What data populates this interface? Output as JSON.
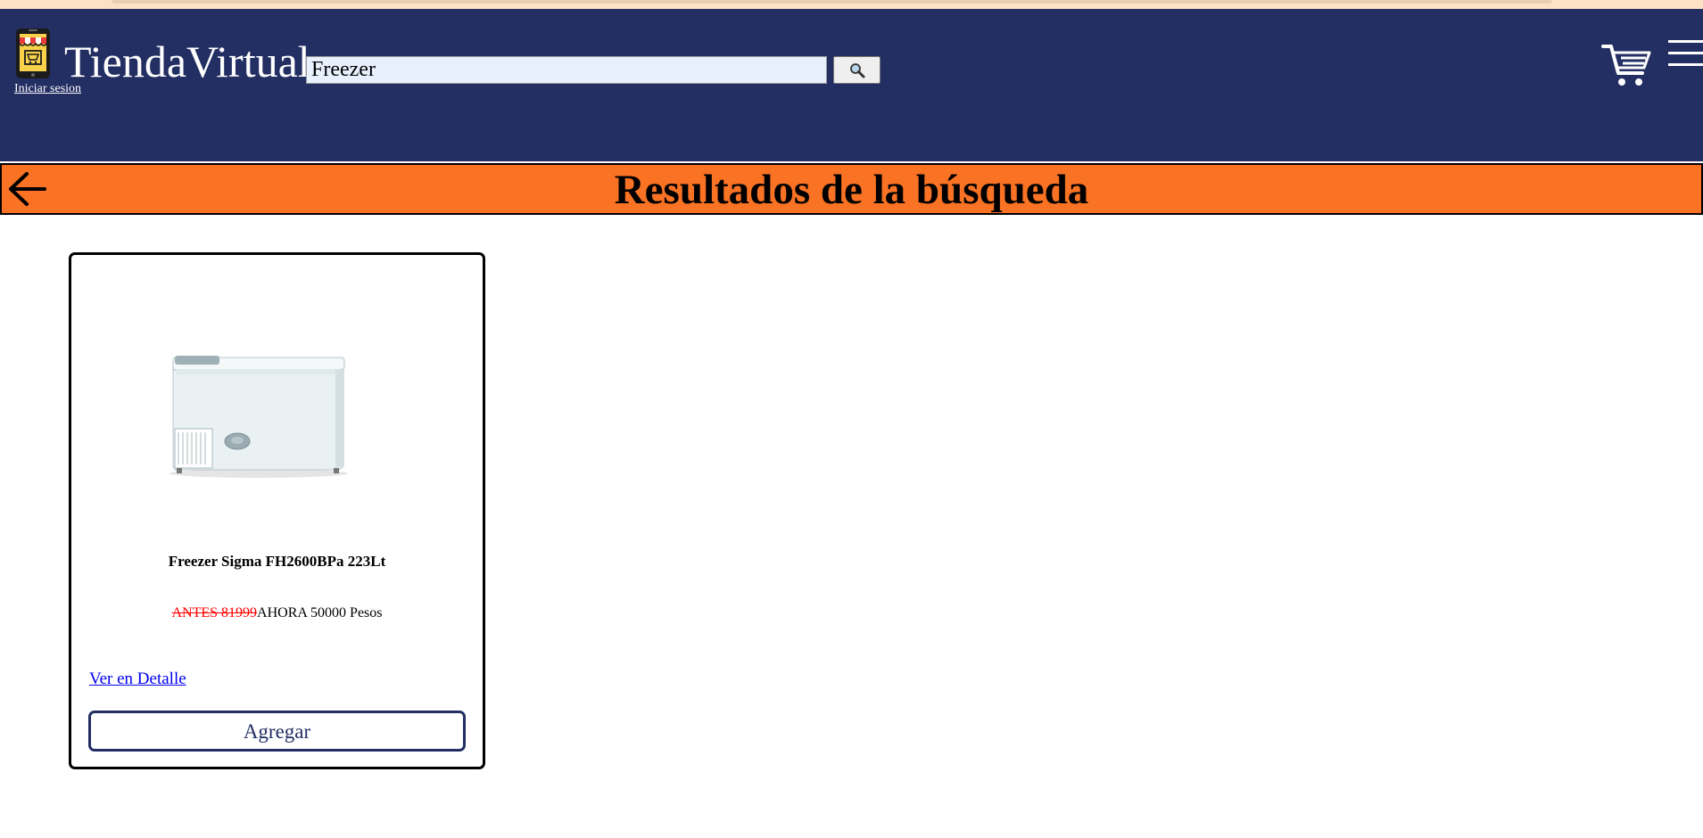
{
  "header": {
    "brand": "TiendaVirtual",
    "login_link": "Iniciar sesion",
    "search_value": "Freezer",
    "icons": {
      "logo": "shop-logo-icon",
      "search": "search-icon",
      "cart": "cart-icon",
      "menu": "hamburger-menu-icon"
    }
  },
  "results": {
    "title": "Resultados de la búsqueda",
    "back_icon": "arrow-left-icon"
  },
  "products": [
    {
      "name": "Freezer Sigma FH2600BPa 223Lt",
      "old_price": "ANTES 81999",
      "new_price": "AHORA 50000 Pesos",
      "detail_link": "Ver en Detalle",
      "add_button": "Agregar",
      "image": "chest-freezer-image"
    }
  ],
  "colors": {
    "header_bg": "#232e63",
    "results_bar_bg": "#fa7223",
    "old_price": "#ff0000",
    "link": "#0000ee"
  }
}
